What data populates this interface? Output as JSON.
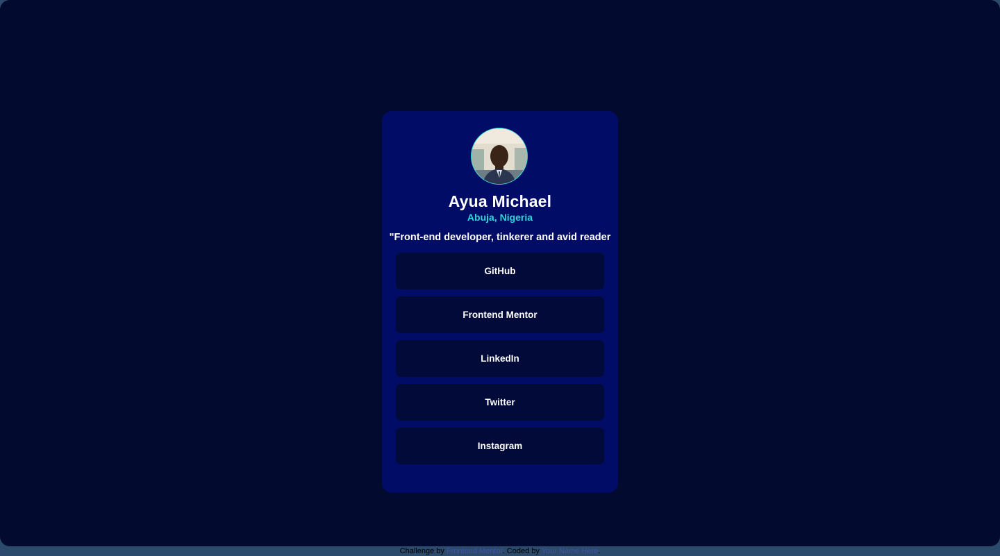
{
  "profile": {
    "name": "Ayua Michael",
    "location": "Abuja, Nigeria",
    "bio": "\"Front-end developer, tinkerer and avid reader"
  },
  "links": [
    {
      "label": "GitHub"
    },
    {
      "label": "Frontend Mentor"
    },
    {
      "label": "LinkedIn"
    },
    {
      "label": "Twitter"
    },
    {
      "label": "Instagram"
    }
  ],
  "attribution": {
    "prefix": "Challenge by",
    "challenge_link": "Frontend Mentor",
    "middle": ". Coded by",
    "author_link": "Your Name Here",
    "suffix": "."
  },
  "colors": {
    "page_background": "#020a30",
    "card_background": "#010c66",
    "button_background": "#020a3a",
    "accent": "#29d8d8",
    "text": "#ffffff",
    "outer_background": "#2c4a6b"
  }
}
